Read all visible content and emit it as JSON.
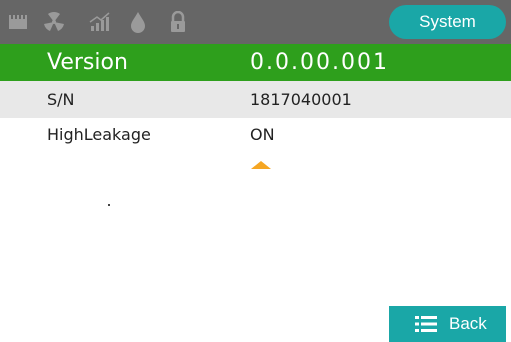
{
  "header": {
    "icons": [
      "memory-card-icon",
      "radiation-icon",
      "signal-chart-icon",
      "water-drop-icon",
      "lock-icon"
    ],
    "system_button": "System"
  },
  "rows": [
    {
      "label": "Version",
      "value": "0.0.00.001"
    },
    {
      "label": "S/N",
      "value": "1817040001"
    },
    {
      "label": "HighLeakage",
      "value": "ON"
    }
  ],
  "footer": {
    "back_label": "Back"
  },
  "colors": {
    "topbar": "#666666",
    "icon": "#9a9a9a",
    "accent_teal": "#1aa7a7",
    "selected_row": "#2e9f1c",
    "alt_row": "#e8e8e8",
    "caret": "#f5a623"
  }
}
